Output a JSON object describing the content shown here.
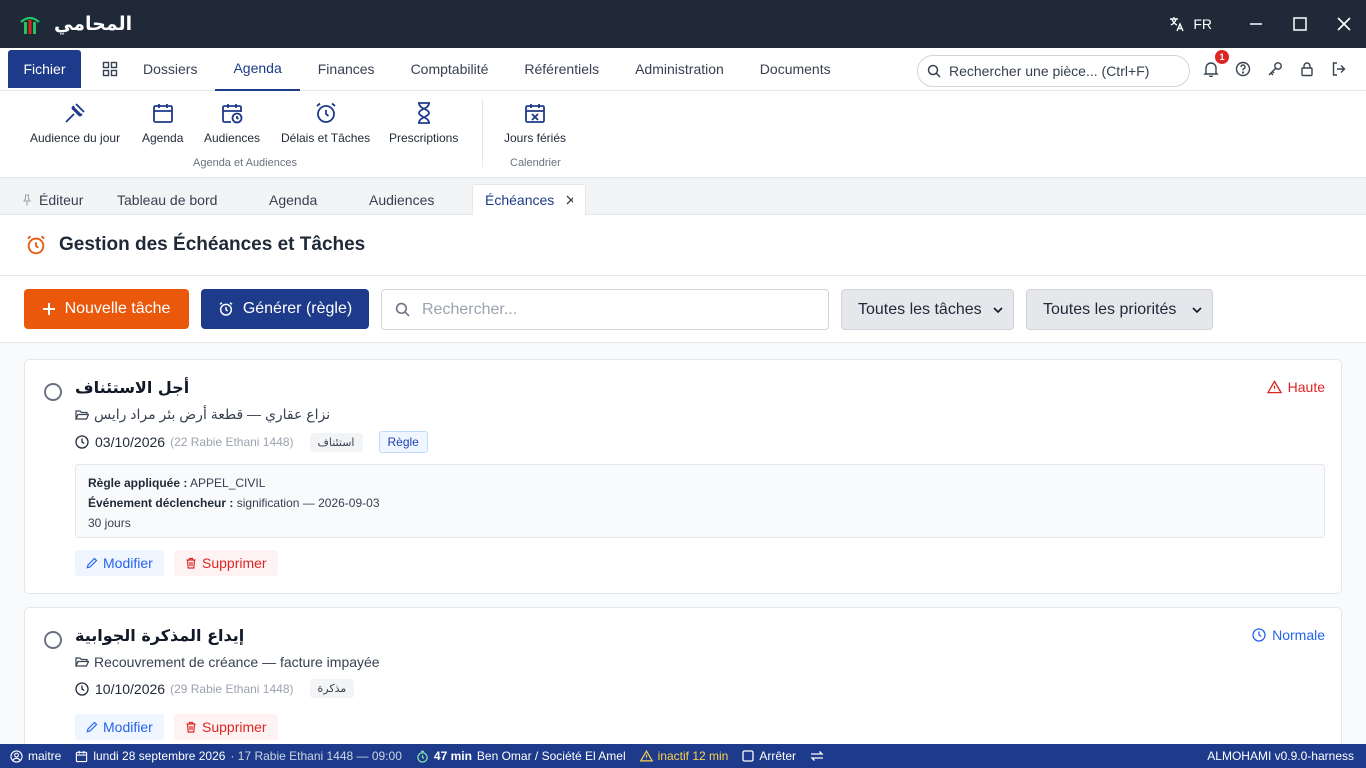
{
  "app": {
    "title": "المحامي",
    "lang": "FR"
  },
  "menu": {
    "fichier": "Fichier",
    "tabs": [
      "Dossiers",
      "Agenda",
      "Finances",
      "Comptabilité",
      "Référentiels",
      "Administration",
      "Documents"
    ],
    "active_tab": "Agenda",
    "search_placeholder": "Rechercher une pièce... (Ctrl+F)",
    "notification_count": "1"
  },
  "ribbon": {
    "buttons": [
      "Audience du jour",
      "Agenda",
      "Audiences",
      "Délais et Tâches",
      "Prescriptions",
      "Jours fériés"
    ],
    "groups": [
      "Agenda et Audiences",
      "Calendrier"
    ]
  },
  "doc_tabs": [
    "Éditeur",
    "Tableau de bord",
    "Agenda",
    "Audiences",
    "Échéances"
  ],
  "page": {
    "title": "Gestion des Échéances et Tâches"
  },
  "toolbar": {
    "new_label": "Nouvelle tâche",
    "generate_label": "Générer (règle)",
    "search_placeholder": "Rechercher...",
    "filter_tasks": "Toutes les tâches",
    "filter_priorities": "Toutes les priorités"
  },
  "tasks": [
    {
      "title": "أجل الاستئناف",
      "folder": "نزاع عقاري — قطعة أرض بئر مراد رايس",
      "date": "03/10/2026",
      "hijri": "(22 Rabie Ethani 1448)",
      "tag": "استئناف",
      "rule_tag": "Règle",
      "priority": "Haute",
      "rule_label": "Règle appliquée :",
      "rule_value": "APPEL_CIVIL",
      "event_label": "Événement déclencheur :",
      "event_value": "signification — 2026-09-03",
      "duration": "30 jours",
      "edit": "Modifier",
      "delete": "Supprimer"
    },
    {
      "title": "إيداع المذكرة الجوابية",
      "folder": "Recouvrement de créance — facture impayée",
      "date": "10/10/2026",
      "hijri": "(29 Rabie Ethani 1448)",
      "tag": "مذكرة",
      "priority": "Normale",
      "edit": "Modifier",
      "delete": "Supprimer"
    }
  ],
  "status": {
    "user": "maitre",
    "date": "lundi 28 septembre 2026",
    "hijri_time": "· 17 Rabie Ethani 1448 — 09:00",
    "timer": "47 min",
    "client": "Ben Omar / Société El Amel",
    "inactive": "inactif 12 min",
    "stop": "Arrêter",
    "version": "ALMOHAMI v0.9.0-harness"
  },
  "colors": {
    "primary": "#1e3a8a",
    "accent": "#ea580c",
    "danger": "#dc2626",
    "info": "#2563eb"
  }
}
